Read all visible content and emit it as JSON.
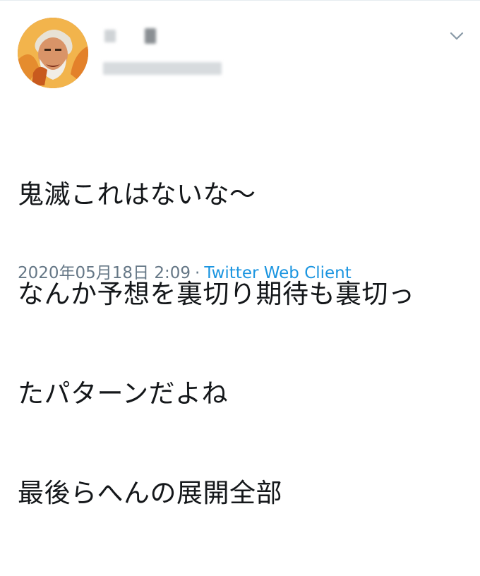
{
  "tweet": {
    "lines": [
      "鬼滅これはないな〜",
      "なんか予想を裏切り期待も裏切っ",
      "たパターンだよね",
      "最後らへんの展開全部"
    ],
    "date": "2020年05月18日 2:09",
    "separator": "·",
    "client": "Twitter Web Client"
  },
  "colors": {
    "link": "#1b95e0",
    "meta": "#657786",
    "text": "#14171a"
  },
  "icons": {
    "menu": "chevron-down-icon",
    "avatar": "avatar"
  }
}
